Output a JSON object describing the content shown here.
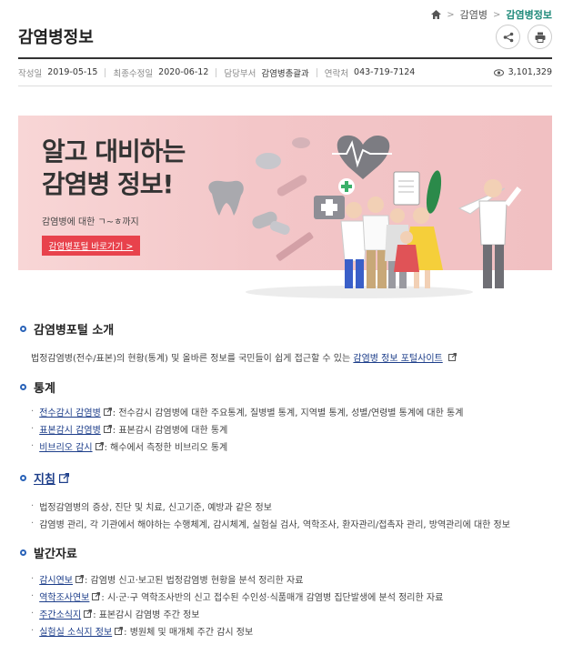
{
  "breadcrumb": {
    "level1": "감염병",
    "current": "감염병정보"
  },
  "page": {
    "title": "감염병정보"
  },
  "meta": {
    "created_label": "작성일",
    "created": "2019-05-15",
    "modified_label": "최종수정일",
    "modified": "2020-06-12",
    "dept_label": "담당부서",
    "dept": "감염병총괄과",
    "contact_label": "연락처",
    "contact": "043-719-7124",
    "views": "3,101,329"
  },
  "banner": {
    "title_line1": "알고 대비하는",
    "title_line2": "감염병 정보!",
    "subtitle": "감염병에 대한 ㄱ~ㅎ까지",
    "button": "감염병포털 바로가기 >"
  },
  "sections": {
    "portal": {
      "title": "감염병포털 소개",
      "text": "법정감염병(전수/표본)의 현황(통계) 및 올바른 정보를 국민들이 쉽게 접근할 수 있는",
      "link": "감염병 정보 포털사이트"
    },
    "stats": {
      "title": "통계",
      "items": [
        {
          "link": "전수감시 감염병",
          "desc": ": 전수감시 감염병에 대한 주요통계, 질병별 통계, 지역별 통계, 성별/연령별 통계에 대한 통계"
        },
        {
          "link": "표본감시 감염병",
          "desc": ": 표본감시 감염병에 대한 통계"
        },
        {
          "link": "비브리오 감시",
          "desc": ": 해수에서 측정한 비브리오 통계"
        }
      ]
    },
    "guide": {
      "title": "지침",
      "items": [
        "법정감염병의 증상, 진단 및 치료, 신고기준, 예방과 같은 정보",
        "감염병 관리, 각 기관에서 해야하는 수행체계, 감시체계, 실험실 검사, 역학조사, 환자관리/접촉자 관리, 방역관리에 대한 정보"
      ]
    },
    "pubs": {
      "title": "발간자료",
      "items": [
        {
          "link": "감시연보",
          "desc": ": 감염병 신고·보고된 법정감염병 현황을 분석 정리한 자료"
        },
        {
          "link": "역학조사연보",
          "desc": ": 시·군·구 역학조사반의 신고 접수된 수인성·식품매개 감염병 집단발생에 분석 정리한 자료"
        },
        {
          "link": "주간소식지",
          "desc": ": 표본감시 감염병 주간 정보"
        },
        {
          "link": "실험실 소식지 정보",
          "desc": ": 병원체 및 매개체 주간 감시 정보"
        }
      ]
    }
  }
}
